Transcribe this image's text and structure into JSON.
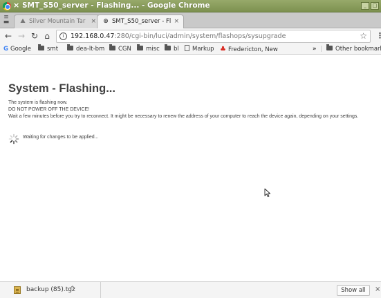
{
  "window": {
    "title": "SMT_S50_server - Flashing... - Google Chrome",
    "close_glyph": "×"
  },
  "tabs": [
    {
      "label": "Silver Mountain Tar",
      "icon": "mountain-icon",
      "active": false
    },
    {
      "label": "SMT_S50_server - Fl",
      "icon": "globe-icon",
      "active": true
    }
  ],
  "toolbar": {
    "url_host": "192.168.0.47",
    "url_rest": ":280/cgi-bin/luci/admin/system/flashops/sysupgrade"
  },
  "bookmarks": {
    "items": [
      {
        "label": "Google",
        "icon": "google-icon"
      },
      {
        "label": "smt",
        "icon": "folder-icon"
      },
      {
        "label": "dea-lt-bm",
        "icon": "folder-icon"
      },
      {
        "label": "CGN",
        "icon": "folder-icon"
      },
      {
        "label": "misc",
        "icon": "folder-icon"
      },
      {
        "label": "bl",
        "icon": "folder-icon"
      },
      {
        "label": "Markup",
        "icon": "page-icon"
      },
      {
        "label": "Fredericton, New",
        "icon": "maple-leaf-icon"
      }
    ],
    "overflow": "»",
    "other": "Other bookmarks"
  },
  "page": {
    "title": "System - Flashing...",
    "line1": "The system is flashing now.",
    "line2": "DO NOT POWER OFF THE DEVICE!",
    "line3": "Wait a few minutes before you try to reconnect. It might be necessary to renew the address of your computer to reach the device again, depending on your settings.",
    "waiting": "Waiting for changes to be applied..."
  },
  "downloads": {
    "file": "backup (85).tgz",
    "show_all": "Show all"
  }
}
